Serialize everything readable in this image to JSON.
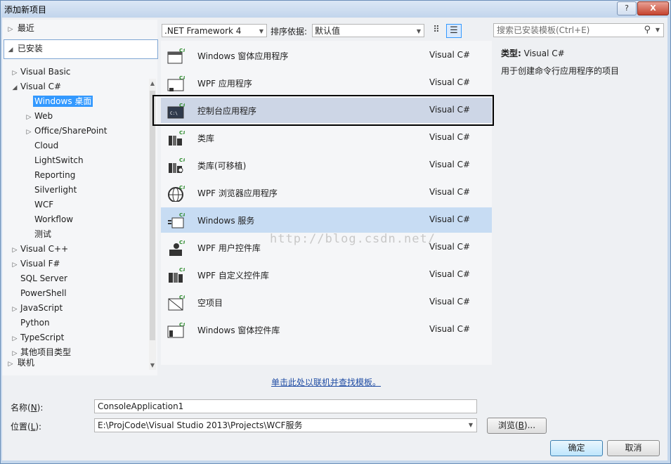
{
  "window": {
    "title": "添加新项目",
    "help_label": "?",
    "close_label": "X"
  },
  "left": {
    "recent": "最近",
    "installed": "已安装",
    "online": "联机",
    "tree": [
      {
        "label": "Visual Basic",
        "arrow": "▷",
        "indent": 1
      },
      {
        "label": "Visual C#",
        "arrow": "◢",
        "indent": 1
      },
      {
        "label": "Windows 桌面",
        "arrow": "",
        "indent": 2,
        "selected": true
      },
      {
        "label": "Web",
        "arrow": "▷",
        "indent": 2
      },
      {
        "label": "Office/SharePoint",
        "arrow": "▷",
        "indent": 2
      },
      {
        "label": "Cloud",
        "arrow": "",
        "indent": 2
      },
      {
        "label": "LightSwitch",
        "arrow": "",
        "indent": 2
      },
      {
        "label": "Reporting",
        "arrow": "",
        "indent": 2
      },
      {
        "label": "Silverlight",
        "arrow": "",
        "indent": 2
      },
      {
        "label": "WCF",
        "arrow": "",
        "indent": 2
      },
      {
        "label": "Workflow",
        "arrow": "",
        "indent": 2
      },
      {
        "label": "测试",
        "arrow": "",
        "indent": 2
      },
      {
        "label": "Visual C++",
        "arrow": "▷",
        "indent": 1
      },
      {
        "label": "Visual F#",
        "arrow": "▷",
        "indent": 1
      },
      {
        "label": "SQL Server",
        "arrow": "",
        "indent": 1
      },
      {
        "label": "PowerShell",
        "arrow": "",
        "indent": 1
      },
      {
        "label": "JavaScript",
        "arrow": "▷",
        "indent": 1
      },
      {
        "label": "Python",
        "arrow": "",
        "indent": 1
      },
      {
        "label": "TypeScript",
        "arrow": "▷",
        "indent": 1
      },
      {
        "label": "其他项目类型",
        "arrow": "▷",
        "indent": 1
      }
    ]
  },
  "toolbar": {
    "framework": ".NET Framework 4",
    "sort_label": "排序依据:",
    "sort_value": "默认值",
    "search_placeholder": "搜索已安装模板(Ctrl+E)"
  },
  "templates": [
    {
      "name": "Windows 窗体应用程序",
      "lang": "Visual C#",
      "icon": "window-icon"
    },
    {
      "name": "WPF 应用程序",
      "lang": "Visual C#",
      "icon": "wpf-app-icon"
    },
    {
      "name": "控制台应用程序",
      "lang": "Visual C#",
      "icon": "console-icon",
      "selected": true
    },
    {
      "name": "类库",
      "lang": "Visual C#",
      "icon": "class-library-icon"
    },
    {
      "name": "类库(可移植)",
      "lang": "Visual C#",
      "icon": "portable-library-icon"
    },
    {
      "name": "WPF 浏览器应用程序",
      "lang": "Visual C#",
      "icon": "globe-icon"
    },
    {
      "name": "Windows 服务",
      "lang": "Visual C#",
      "icon": "service-icon",
      "hover": true
    },
    {
      "name": "WPF 用户控件库",
      "lang": "Visual C#",
      "icon": "user-control-icon"
    },
    {
      "name": "WPF 自定义控件库",
      "lang": "Visual C#",
      "icon": "custom-control-icon"
    },
    {
      "name": "空项目",
      "lang": "Visual C#",
      "icon": "empty-project-icon"
    },
    {
      "name": "Windows 窗体控件库",
      "lang": "Visual C#",
      "icon": "forms-control-icon"
    }
  ],
  "info": {
    "type_label": "类型:",
    "type_value": "Visual C#",
    "description": "用于创建命令行应用程序的项目"
  },
  "online_link": "单击此处以联机并查找模板。",
  "watermark": "http://blog.csdn.net/",
  "form": {
    "name_label": "名称(",
    "name_key": "N",
    "name_label_end": "):",
    "name_value": "ConsoleApplication1",
    "location_label": "位置(",
    "location_key": "L",
    "location_label_end": "):",
    "location_value": "E:\\ProjCode\\Visual Studio 2013\\Projects\\WCF服务",
    "browse_label": "浏览(",
    "browse_key": "B",
    "browse_label_end": ")...",
    "ok_label": "确定",
    "cancel_label": "取消"
  },
  "colors": {
    "selection_blue": "#3399ff",
    "hover_row": "#c7dcf3",
    "selected_row": "#cdd6e6",
    "link": "#1f4ca4"
  }
}
